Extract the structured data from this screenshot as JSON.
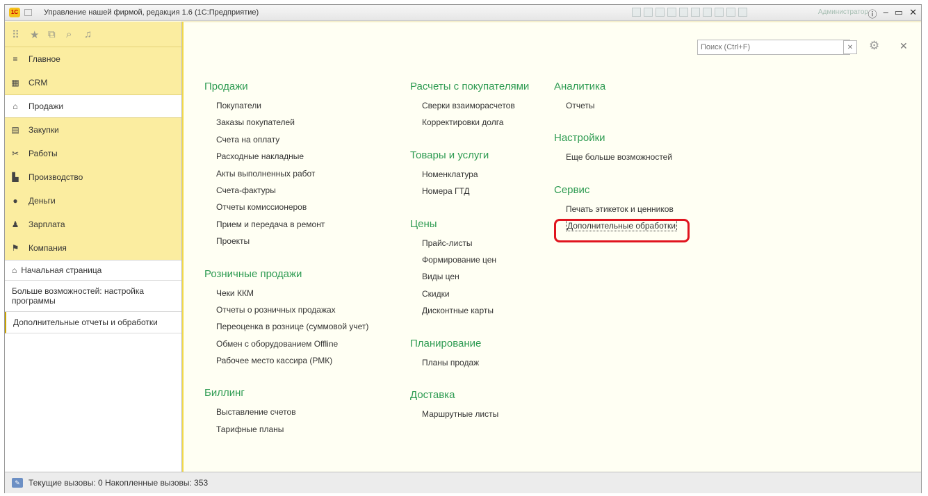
{
  "window": {
    "title": "Управление нашей фирмой, редакция 1.6  (1С:Предприятие)",
    "user": "Администратор"
  },
  "sidebar": {
    "sections": [
      {
        "label": "Главное",
        "icon": "menu-lines-icon"
      },
      {
        "label": "CRM",
        "icon": "crm-icon"
      },
      {
        "label": "Продажи",
        "icon": "sales-icon",
        "active": true
      },
      {
        "label": "Закупки",
        "icon": "purchases-icon"
      },
      {
        "label": "Работы",
        "icon": "works-icon"
      },
      {
        "label": "Производство",
        "icon": "production-icon"
      },
      {
        "label": "Деньги",
        "icon": "money-icon"
      },
      {
        "label": "Зарплата",
        "icon": "salary-icon"
      },
      {
        "label": "Компания",
        "icon": "company-icon"
      }
    ],
    "links": {
      "home": "Начальная страница",
      "more": "Больше возможностей: настройка программы",
      "extra": "Дополнительные отчеты и обработки"
    }
  },
  "main": {
    "search_placeholder": "Поиск (Ctrl+F)",
    "columns": [
      {
        "groups": [
          {
            "title": "Продажи",
            "items": [
              "Покупатели",
              "Заказы покупателей",
              "Счета на оплату",
              "Расходные накладные",
              "Акты выполненных работ",
              "Счета-фактуры",
              "Отчеты комиссионеров",
              "Прием и передача в ремонт",
              "Проекты"
            ]
          },
          {
            "title": "Розничные продажи",
            "items": [
              "Чеки ККМ",
              "Отчеты о розничных продажах",
              "Переоценка в рознице (суммовой учет)",
              "Обмен с оборудованием Offline",
              "Рабочее место кассира (РМК)"
            ]
          },
          {
            "title": "Биллинг",
            "items": [
              "Выставление счетов",
              "Тарифные планы"
            ]
          }
        ]
      },
      {
        "groups": [
          {
            "title": "Расчеты с покупателями",
            "items": [
              "Сверки взаиморасчетов",
              "Корректировки долга"
            ]
          },
          {
            "title": "Товары и услуги",
            "items": [
              "Номенклатура",
              "Номера ГТД"
            ]
          },
          {
            "title": "Цены",
            "items": [
              "Прайс-листы",
              "Формирование цен",
              "Виды цен",
              "Скидки",
              "Дисконтные карты"
            ]
          },
          {
            "title": "Планирование",
            "items": [
              "Планы продаж"
            ]
          },
          {
            "title": "Доставка",
            "items": [
              "Маршрутные листы"
            ]
          }
        ]
      },
      {
        "groups": [
          {
            "title": "Аналитика",
            "items": [
              "Отчеты"
            ]
          },
          {
            "title": "Настройки",
            "items": [
              "Еще больше возможностей"
            ]
          },
          {
            "title": "Сервис",
            "items": [
              "Печать этикеток и ценников",
              "Дополнительные обработки"
            ]
          }
        ]
      }
    ]
  },
  "status": {
    "text": "Текущие вызовы: 0   Накопленные вызовы: 353"
  },
  "colors": {
    "accent_green": "#2e9b52",
    "sidebar_yellow": "#fbeda0",
    "highlight_red": "#e0141e"
  }
}
